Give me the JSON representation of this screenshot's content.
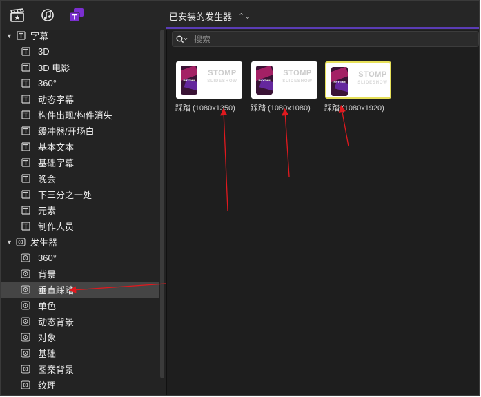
{
  "toolbar": {
    "icons": [
      "clapperboard-star-icon",
      "music-note-icon",
      "titles-generators-icon"
    ],
    "accent_color": "#7b2fd0"
  },
  "browser": {
    "title": "已安装的发生器",
    "search_placeholder": "搜索"
  },
  "sidebar": {
    "categories": [
      {
        "label": "字幕",
        "icon": "titles-icon",
        "items": [
          "3D",
          "3D 电影",
          "360°",
          "动态字幕",
          "构件出现/构件消失",
          "缓冲器/开场白",
          "基本文本",
          "基础字幕",
          "晚会",
          "下三分之一处",
          "元素",
          "制作人员"
        ]
      },
      {
        "label": "发生器",
        "icon": "generator-icon",
        "items": [
          "360°",
          "背景",
          "垂直踩踏",
          "单色",
          "动态背景",
          "对象",
          "基础",
          "图案背景",
          "纹理"
        ]
      }
    ],
    "selected_item": "垂直踩踏"
  },
  "thumbnails": [
    {
      "caption": "踩踏 (1080x1350)",
      "big_text": "STOMP",
      "small_text": "SLIDESHOW",
      "phone_text": "RHYTHM",
      "selected": false
    },
    {
      "caption": "踩踏 (1080x1080)",
      "big_text": "STOMP",
      "small_text": "SLIDESHOW",
      "phone_text": "RHYTHM",
      "selected": false
    },
    {
      "caption": "踩踏 (1080x1920)",
      "big_text": "STOMP",
      "small_text": "SLIDESHOW",
      "phone_text": "RHYTHM",
      "selected": true
    }
  ],
  "annotation_color": "#e0191e"
}
